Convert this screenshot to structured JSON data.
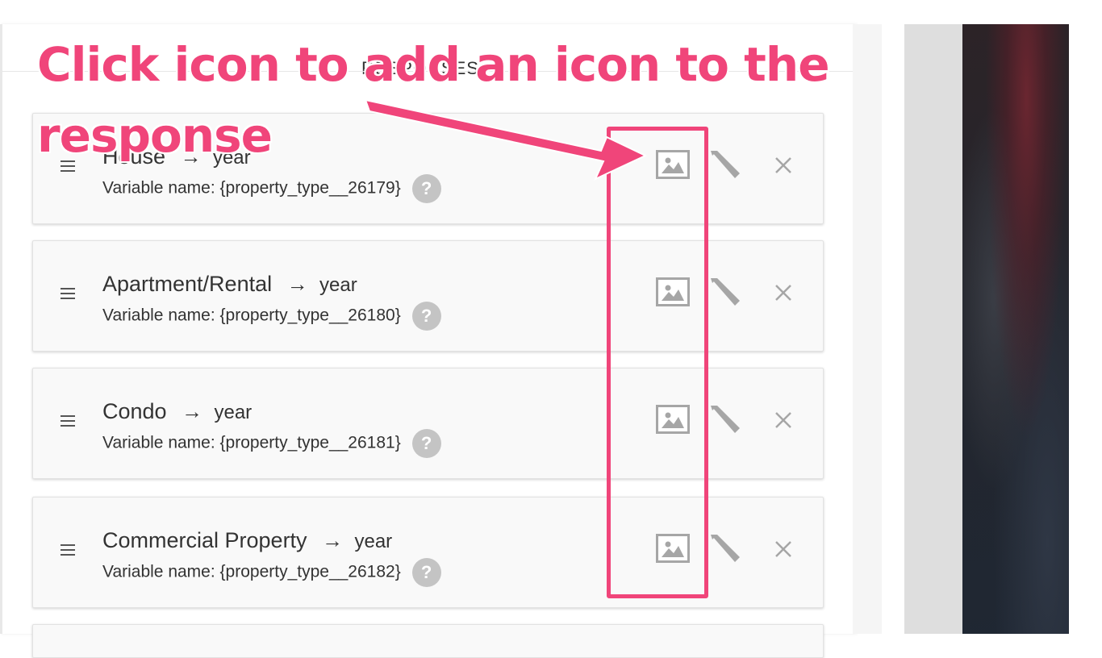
{
  "header": {
    "title": "RESPONSES"
  },
  "responses": [
    {
      "label": "House",
      "arrow": "→",
      "target": "year",
      "variable": "Variable name: {property_type__26179}",
      "help": "?"
    },
    {
      "label": "Apartment/Rental",
      "arrow": "→",
      "target": "year",
      "variable": "Variable name: {property_type__26180}",
      "help": "?"
    },
    {
      "label": "Condo",
      "arrow": "→",
      "target": "year",
      "variable": "Variable name: {property_type__26181}",
      "help": "?"
    },
    {
      "label": "Commercial Property",
      "arrow": "→",
      "target": "year",
      "variable": "Variable name: {property_type__26182}",
      "help": "?"
    }
  ],
  "annotation": {
    "text": "Click icon to add an icon to the response",
    "color": "#f0457a"
  },
  "icons": {
    "drag": "drag-handle-icon",
    "image": "image-icon",
    "edit": "pencil-icon",
    "delete": "close-icon"
  }
}
